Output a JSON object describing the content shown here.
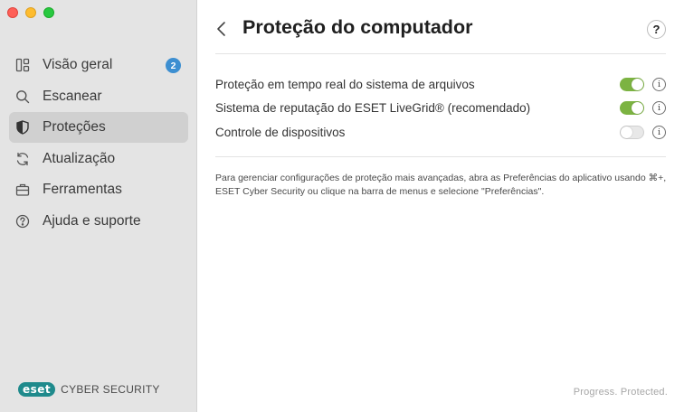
{
  "sidebar": {
    "items": [
      {
        "label": "Visão geral",
        "icon": "dashboard-icon",
        "badge": "2",
        "active": false
      },
      {
        "label": "Escanear",
        "icon": "search-icon",
        "active": false
      },
      {
        "label": "Proteções",
        "icon": "shield-icon",
        "active": true
      },
      {
        "label": "Atualização",
        "icon": "refresh-icon",
        "active": false
      },
      {
        "label": "Ferramentas",
        "icon": "briefcase-icon",
        "active": false
      },
      {
        "label": "Ajuda e suporte",
        "icon": "help-circle-icon",
        "active": false
      }
    ],
    "brand": {
      "logo": "eset",
      "product": "CYBER SECURITY"
    }
  },
  "header": {
    "title": "Proteção do computador",
    "help": "?"
  },
  "settings": [
    {
      "label": "Proteção em tempo real do sistema de arquivos",
      "enabled": true
    },
    {
      "label": "Sistema de reputação do ESET LiveGrid® (recomendado)",
      "enabled": true
    },
    {
      "label": "Controle de dispositivos",
      "enabled": false
    }
  ],
  "info_glyph": "i",
  "note": "Para gerenciar configurações de proteção mais avançadas, abra as Preferências do aplicativo usando ⌘+, ESET Cyber Security ou clique na barra de menus e selecione \"Preferências\".",
  "footer": "Progress. Protected.",
  "colors": {
    "accent_green": "#7cb342",
    "badge_blue": "#3d8fd1",
    "brand_teal": "#1f8a8c"
  }
}
